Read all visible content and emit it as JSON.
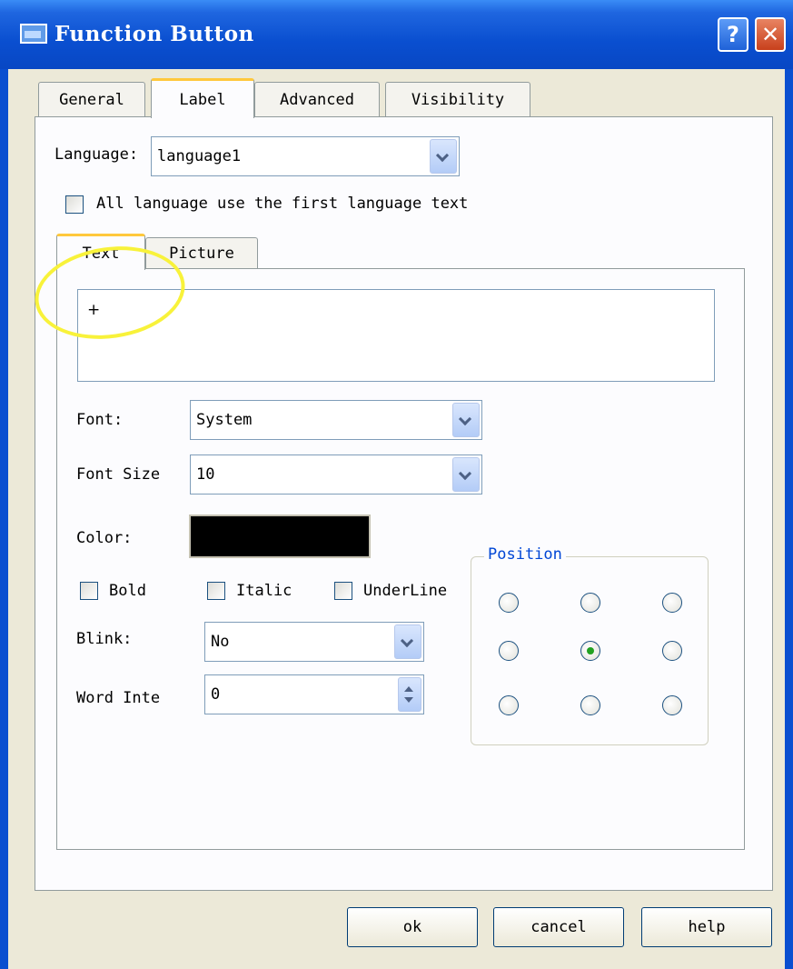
{
  "window": {
    "title": "Function Button",
    "help_glyph": "?",
    "close_glyph": "✕"
  },
  "tabs": [
    {
      "label": "General"
    },
    {
      "label": "Label",
      "active": true
    },
    {
      "label": "Advanced"
    },
    {
      "label": "Visibility"
    }
  ],
  "language": {
    "label": "Language:",
    "value": "language1"
  },
  "all_language_checkbox": {
    "label": "All language use the first language text",
    "checked": false
  },
  "inner_tabs": [
    {
      "label": "Text",
      "active": true
    },
    {
      "label": "Picture"
    }
  ],
  "text_content": "+",
  "font": {
    "label": "Font:",
    "value": "System"
  },
  "font_size": {
    "label": "Font Size",
    "value": "10"
  },
  "color": {
    "label": "Color:",
    "value": "#000000"
  },
  "style_checkboxes": {
    "bold": "Bold",
    "italic": "Italic",
    "underline": "UnderLine"
  },
  "blink": {
    "label": "Blink:",
    "value": "No"
  },
  "word_interval": {
    "label": "Word Inte",
    "value": "0"
  },
  "position": {
    "legend": "Position",
    "selected": "middle-center"
  },
  "buttons": {
    "ok": "ok",
    "cancel": "cancel",
    "help": "help"
  },
  "colors": {
    "titlebar": "#0a4fd0",
    "dialog_bg": "#ece9d8",
    "highlight": "#f8f23a",
    "legend_text": "#0046d5"
  }
}
